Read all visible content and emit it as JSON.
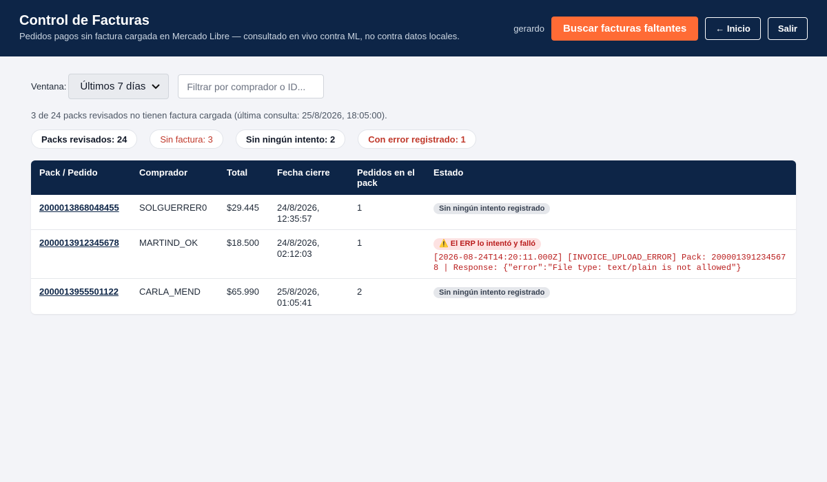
{
  "header": {
    "title": "Control de Facturas",
    "subtitle": "Pedidos pagos sin factura cargada en Mercado Libre — consultado en vivo contra ML, no contra datos locales.",
    "username": "gerardo",
    "search_missing_label": "Buscar facturas faltantes",
    "home_label": "← Inicio",
    "logout_label": "Salir"
  },
  "controls": {
    "window_label": "Ventana:",
    "window_value": "Últimos 7 días",
    "filter_placeholder": "Filtrar por comprador o ID..."
  },
  "summary": "3 de 24 packs revisados no tienen factura cargada (última consulta: 25/8/2026, 18:05:00).",
  "pills": {
    "reviewed": "Packs revisados: 24",
    "no_invoice": "Sin factura: 3",
    "no_attempt": "Sin ningún intento: 2",
    "with_error": "Con error registrado: 1"
  },
  "table": {
    "headers": [
      "Pack / Pedido",
      "Comprador",
      "Total",
      "Fecha cierre",
      "Pedidos en el pack",
      "Estado"
    ],
    "rows": [
      {
        "id": "2000013868048455",
        "buyer": "SOLGUERRER0",
        "total": "$29.445",
        "date_line1": "24/8/2026,",
        "date_line2": "12:35:57",
        "orders": "1",
        "status": "Sin ningún intento registrado",
        "error": ""
      },
      {
        "id": "2000013912345678",
        "buyer": "MARTIND_OK",
        "total": "$18.500",
        "date_line1": "24/8/2026,",
        "date_line2": "02:12:03",
        "orders": "1",
        "status": "⚠️ El ERP lo intentó y falló",
        "error": "[2026-08-24T14:20:11.000Z] [INVOICE_UPLOAD_ERROR] Pack: 2000013912345678 | Response: {\"error\":\"File type: text/plain is not allowed\"}"
      },
      {
        "id": "2000013955501122",
        "buyer": "CARLA_MEND",
        "total": "$65.990",
        "date_line1": "25/8/2026,",
        "date_line2": "01:05:41",
        "orders": "2",
        "status": "Sin ningún intento registrado",
        "error": ""
      }
    ]
  },
  "colors": {
    "header_bg": "#0d2547",
    "accent": "#ff6b35",
    "error": "#b91c1c"
  }
}
